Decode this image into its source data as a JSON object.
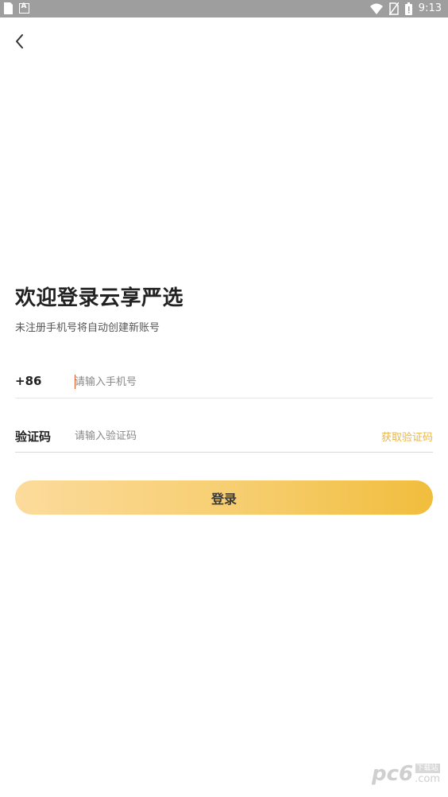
{
  "status_bar": {
    "time": "9:13",
    "left_icons": [
      "sim-card-icon",
      "app-a-icon"
    ],
    "app_icon_letter": "A",
    "right_icons": [
      "wifi-icon",
      "no-sim-icon",
      "battery-icon"
    ]
  },
  "nav": {
    "back_icon": "chevron-left-icon"
  },
  "header": {
    "title": "欢迎登录云享严选",
    "subtitle": "未注册手机号将自动创建新账号"
  },
  "phone_row": {
    "prefix": "+86",
    "placeholder": "请输入手机号",
    "value": ""
  },
  "code_row": {
    "label": "验证码",
    "placeholder": "请输入验证码",
    "value": "",
    "get_code_label": "获取验证码"
  },
  "login_button": {
    "label": "登录"
  },
  "watermark": {
    "main": "pc6",
    "tag": "下载站",
    "suffix": ".com"
  },
  "colors": {
    "status_bar": "#9e9e9e",
    "accent": "#e8b64a",
    "button_start": "#fcdb9c",
    "button_end": "#f1bd3c",
    "caret": "#e0542a"
  }
}
